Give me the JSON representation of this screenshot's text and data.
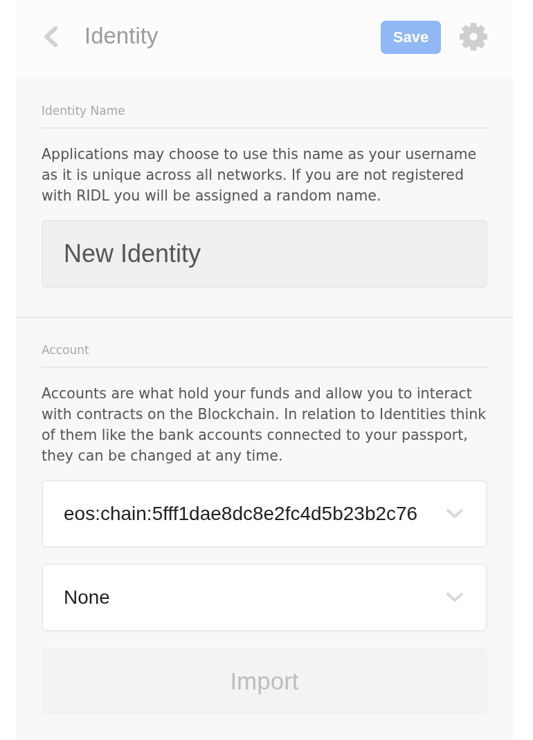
{
  "header": {
    "title": "Identity",
    "save_button": "Save"
  },
  "sections": [
    {
      "label": "Identity Name",
      "description": "Applications may choose to use this name as your username as it is unique across all networks. If you are not registered with RIDL you will be assigned a random name.",
      "fields": [
        {
          "kind": "input",
          "value": "New Identity"
        }
      ]
    },
    {
      "label": "Account",
      "description": "Accounts are what hold your funds and allow you to interact with contracts on the Blockchain. In relation to Identities think of them like the bank accounts connected to your passport, they can be changed at any time.",
      "fields": [
        {
          "kind": "select",
          "value": "eos:chain:5fff1dae8dc8e2fc4d5b23b2c76"
        },
        {
          "kind": "select",
          "value": "None"
        },
        {
          "kind": "button",
          "label": "Import",
          "disabled": true
        }
      ]
    }
  ]
}
